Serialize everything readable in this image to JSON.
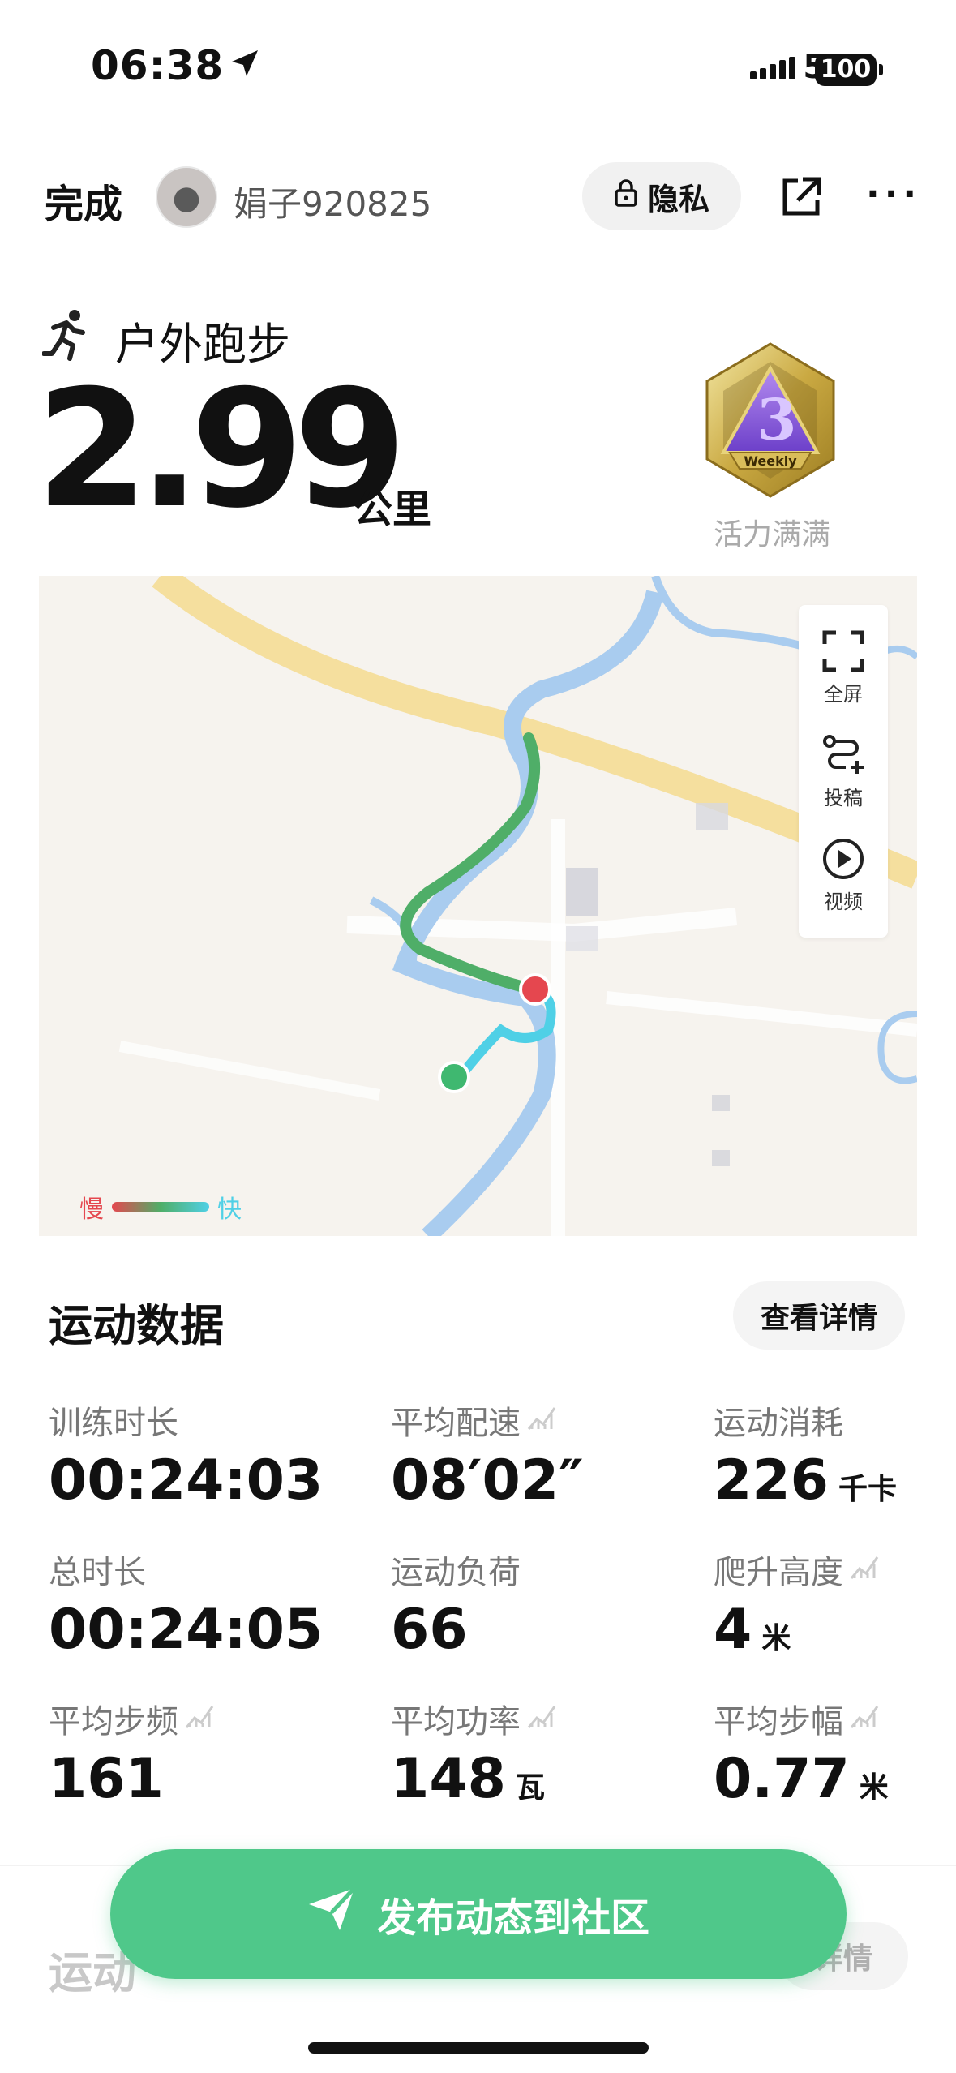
{
  "status": {
    "time": "06:38",
    "network": "5G",
    "battery": "100"
  },
  "header": {
    "done": "完成",
    "username": "娟子920825",
    "privacy": "隐私"
  },
  "activity": {
    "name": "户外跑步",
    "distance": "2.99",
    "unit": "公里",
    "medal_label": "活力满满",
    "medal_text": "Weekly"
  },
  "map": {
    "tools": {
      "fullscreen": "全屏",
      "submit": "投稿",
      "video": "视频"
    },
    "legend": {
      "slow": "慢",
      "fast": "快"
    }
  },
  "stats": {
    "title": "运动数据",
    "detail_button": "查看详情",
    "items": [
      {
        "label": "训练时长",
        "value": "00:24:03",
        "unit": ""
      },
      {
        "label": "平均配速",
        "value": "08′02″",
        "unit": ""
      },
      {
        "label": "运动消耗",
        "value": "226",
        "unit": "千卡"
      },
      {
        "label": "总时长",
        "value": "00:24:05",
        "unit": ""
      },
      {
        "label": "运动负荷",
        "value": "66",
        "unit": ""
      },
      {
        "label": "爬升高度",
        "value": "4",
        "unit": "米"
      },
      {
        "label": "平均步频",
        "value": "161",
        "unit": ""
      },
      {
        "label": "平均功率",
        "value": "148",
        "unit": "瓦"
      },
      {
        "label": "平均步幅",
        "value": "0.77",
        "unit": "米"
      }
    ]
  },
  "section2": {
    "title": "运动",
    "detail_button": "详情"
  },
  "fab": {
    "label": "发布动态到社区"
  },
  "colors": {
    "accent": "#4fc88a",
    "slow": "#e5474f",
    "fast": "#4fd0e6",
    "river": "#a9ccef",
    "road": "#f5df9e"
  }
}
